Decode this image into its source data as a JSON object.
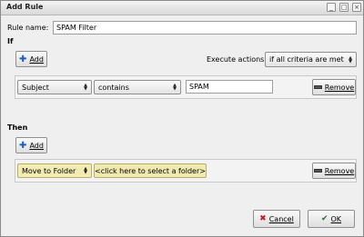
{
  "window": {
    "title": "Add Rule",
    "controls": {
      "minimize": "_",
      "maximize": "□",
      "close": "×"
    }
  },
  "rule": {
    "name_label": "Rule name:",
    "name_value": "SPAM Filter"
  },
  "if_section": {
    "heading": "If",
    "add_label": "Add",
    "execute_label": "Execute actions",
    "execute_value": "if all criteria are met",
    "criteria": [
      {
        "field": "Subject",
        "operator": "contains",
        "value": "SPAM",
        "remove_label": "Remove"
      }
    ]
  },
  "then_section": {
    "heading": "Then",
    "add_label": "Add",
    "actions": [
      {
        "action": "Move to Folder",
        "folder": "<click here to select a folder>",
        "remove_label": "Remove"
      }
    ]
  },
  "footer": {
    "cancel_label": "Cancel",
    "ok_label": "OK"
  }
}
